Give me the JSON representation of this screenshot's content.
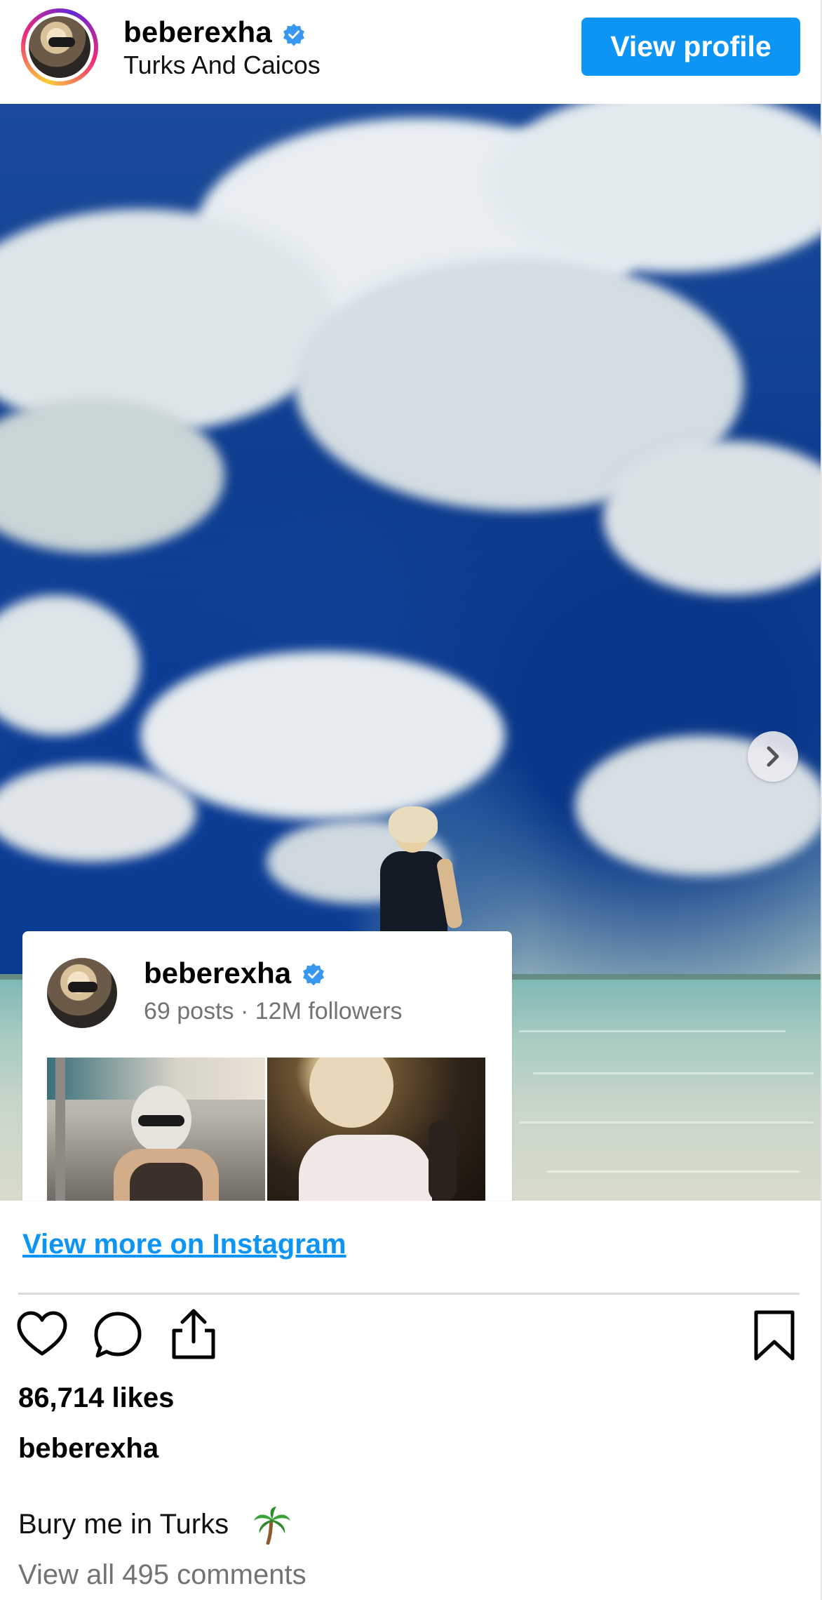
{
  "header": {
    "username": "beberexha",
    "location": "Turks And Caicos",
    "view_profile_label": "View profile"
  },
  "card": {
    "username": "beberexha",
    "stats": "69 posts · 12M followers"
  },
  "links": {
    "view_more": "View more on Instagram"
  },
  "post": {
    "likes": "86,714 likes",
    "caption_user": "beberexha",
    "caption_text": "Bury me in Turks",
    "caption_emoji_icon": "palm-tree-icon",
    "view_comments": "View all 495 comments"
  },
  "icons": [
    "verified-badge-icon",
    "chevron-right-icon",
    "heart-icon",
    "comment-icon",
    "share-icon",
    "bookmark-icon"
  ],
  "colors": {
    "accent": "#0d95f6",
    "verified": "#3897f0",
    "muted_text": "#737373"
  }
}
